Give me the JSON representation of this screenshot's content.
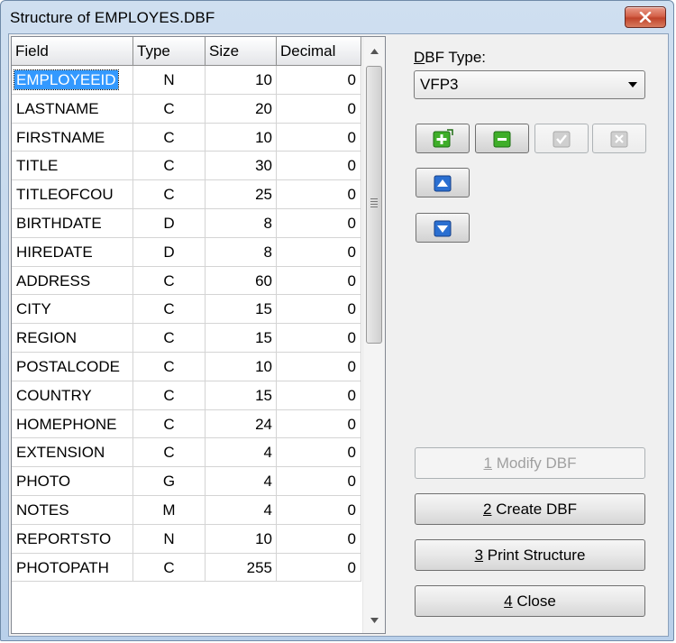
{
  "window": {
    "title": "Structure of EMPLOYES.DBF"
  },
  "grid": {
    "columns": [
      "Field",
      "Type",
      "Size",
      "Decimal"
    ],
    "rows": [
      {
        "field": "EMPLOYEEID",
        "type": "N",
        "size": "10",
        "decimal": "0"
      },
      {
        "field": "LASTNAME",
        "type": "C",
        "size": "20",
        "decimal": "0"
      },
      {
        "field": "FIRSTNAME",
        "type": "C",
        "size": "10",
        "decimal": "0"
      },
      {
        "field": "TITLE",
        "type": "C",
        "size": "30",
        "decimal": "0"
      },
      {
        "field": "TITLEOFCOU",
        "type": "C",
        "size": "25",
        "decimal": "0"
      },
      {
        "field": "BIRTHDATE",
        "type": "D",
        "size": "8",
        "decimal": "0"
      },
      {
        "field": "HIREDATE",
        "type": "D",
        "size": "8",
        "decimal": "0"
      },
      {
        "field": "ADDRESS",
        "type": "C",
        "size": "60",
        "decimal": "0"
      },
      {
        "field": "CITY",
        "type": "C",
        "size": "15",
        "decimal": "0"
      },
      {
        "field": "REGION",
        "type": "C",
        "size": "15",
        "decimal": "0"
      },
      {
        "field": "POSTALCODE",
        "type": "C",
        "size": "10",
        "decimal": "0"
      },
      {
        "field": "COUNTRY",
        "type": "C",
        "size": "15",
        "decimal": "0"
      },
      {
        "field": "HOMEPHONE",
        "type": "C",
        "size": "24",
        "decimal": "0"
      },
      {
        "field": "EXTENSION",
        "type": "C",
        "size": "4",
        "decimal": "0"
      },
      {
        "field": "PHOTO",
        "type": "G",
        "size": "4",
        "decimal": "0"
      },
      {
        "field": "NOTES",
        "type": "M",
        "size": "4",
        "decimal": "0"
      },
      {
        "field": "REPORTSTO",
        "type": "N",
        "size": "10",
        "decimal": "0"
      },
      {
        "field": "PHOTOPATH",
        "type": "C",
        "size": "255",
        "decimal": "0"
      }
    ]
  },
  "panel": {
    "dbf_type_label_key": "D",
    "dbf_type_label_rest": "BF Type:",
    "dbf_type_value": "VFP3",
    "icon_buttons": [
      "add-field-icon",
      "remove-field-icon",
      "confirm-icon",
      "cancel-icon",
      "move-up-icon",
      "move-down-icon"
    ],
    "modify": {
      "key": "1",
      "label": " Modify DBF"
    },
    "create": {
      "key": "2",
      "label": " Create DBF"
    },
    "print": {
      "key": "3",
      "label": " Print Structure"
    },
    "close": {
      "key": "4",
      "label": " Close"
    }
  },
  "colors": {
    "selection": "#3399ff",
    "add_green": "#3fae29",
    "move_blue": "#2a6fd1",
    "close_red": "#c0442b"
  }
}
